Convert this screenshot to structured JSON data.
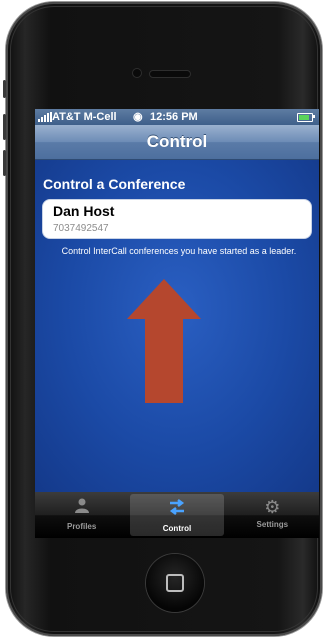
{
  "status_bar": {
    "carrier": "AT&T M-Cell",
    "time": "12:56 PM"
  },
  "nav_bar": {
    "title": "Control"
  },
  "content": {
    "section_title": "Control a Conference",
    "conference": {
      "name": "Dan Host",
      "number": "7037492547"
    },
    "help_text": "Control InterCall conferences you have started as a leader."
  },
  "tab_bar": {
    "tabs": [
      {
        "label": "Profiles",
        "icon": "person-icon",
        "active": false
      },
      {
        "label": "Control",
        "icon": "swap-arrows-icon",
        "active": true
      },
      {
        "label": "Settings",
        "icon": "gear-icon",
        "active": false
      }
    ]
  },
  "colors": {
    "screen_blue": "#1b4aa6",
    "annotation_arrow": "#b5472e",
    "active_tab_icon": "#4aa3ff"
  }
}
